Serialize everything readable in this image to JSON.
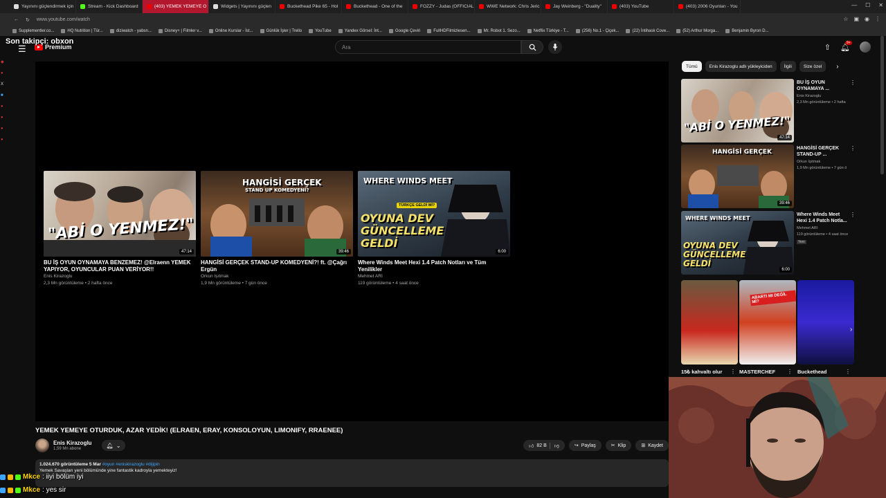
{
  "browser": {
    "tabs": [
      {
        "label": "Yayınını güçlendirmek için",
        "fav": "wh"
      },
      {
        "label": "Stream - Kick Dashboard",
        "fav": "kick"
      },
      {
        "label": "(403) YEMEK YEMEYE O",
        "fav": "yt",
        "active": true
      },
      {
        "label": "Widgets | Yayınını güçlen",
        "fav": "wh"
      },
      {
        "label": "Buckethead Pike 65 - Hol",
        "fav": "yt"
      },
      {
        "label": "Buckethead - One of the",
        "fav": "yt"
      },
      {
        "label": "FOZZY - Judas (OFFICIAL",
        "fav": "yt"
      },
      {
        "label": "WWE Network: Chris Jeric",
        "fav": "yt"
      },
      {
        "label": "Jay Weinberg - \"Duality\"",
        "fav": "yt"
      },
      {
        "label": "(403) YouTube",
        "fav": "yt"
      },
      {
        "label": "(403) 2006 Oyunları - You",
        "fav": "yt"
      }
    ],
    "url": "www.youtube.com/watch",
    "bookmarks": [
      "Supplementler.co...",
      "HQ Nutrition | Tür...",
      "diziwatch - yabsn...",
      "Disney+ | Filmler v...",
      "Online Kurslar - İst...",
      "Günlük İşler | Trello",
      "YouTube",
      "Yandex Görsel: İnt...",
      "Google Çeviri",
      "FullHDFilmizlesen...",
      "Mr. Robot 1. Sezo...",
      "Netflix Türkiye - T...",
      "(256) No.1 - Çiçek...",
      "(22) İntihask Cove...",
      "(52) Arthur Morga...",
      "Benjamin Byron D..."
    ]
  },
  "overlay": {
    "last_follower": "Son takipçi: obxon"
  },
  "header": {
    "logo_label": "Premium",
    "search_placeholder": "Ara",
    "notif_count": "9+"
  },
  "endcards": [
    {
      "title": "BU İŞ OYUN OYNAMAYA BENZEMEZ! @Elraenn YEMEK YAPIYOR, OYUNCULAR PUAN VERİYOR!!",
      "channel": "Enis Kirazoglu",
      "meta": "2,3 Mn görüntüleme • 2 hafta önce",
      "duration": "47:14",
      "thumb_text": "\"ABİ O YENMEZ!\""
    },
    {
      "title": "HANGİSİ GERÇEK STAND-UP KOMEDYENİ?! ft. @Çağrı Ergün",
      "channel": "Orkun Işıtmak",
      "meta": "1,9 Mn görüntüleme • 7 gün önce",
      "duration": "39:46",
      "thumb_text": "HANGİSİ GERÇEK",
      "thumb_sub": "STAND UP KOMEDYENİ?"
    },
    {
      "title": "Where Winds Meet Hexi 1.4 Patch Notları ve Tüm Yenilikler",
      "channel": "Mehmet ARI",
      "meta": "119 görüntüleme • 4 saat önce",
      "duration": "6:00",
      "thumb_text": "OYUNA DEV GÜNCELLEME GELDİ",
      "thumb_top": "WHERE WINDS MEET",
      "thumb_badge": "TÜRKÇE GELDİ Mİ?"
    }
  ],
  "video": {
    "title": "YEMEK YEMEYE OTURDUK, AZAR YEDİK! (ELRAEN, ERAY, KONSOLOYUN, LIMONIFY, RRAENEE)",
    "channel": "Enis Kirazoglu",
    "subs": "1,59 Mn abone",
    "likes": "82 B",
    "share": "Paylaş",
    "clip": "Klip",
    "save": "Kaydet",
    "views_date": "1.024.670 görüntüleme  5 Mar",
    "tags": "#oyun #eniskirazoglu #dijipin",
    "desc_line": "Yemek Savaşları yeni bölümünde yine fantastik kadroyla yemekteyiz!"
  },
  "sidebar": {
    "chips": [
      "Tümü",
      "Enis Kirazoglu adlı yükleyiciden",
      "İlgili",
      "Size özel"
    ],
    "recs": [
      {
        "title": "BU İŞ OYUN OYNAMAYA ...",
        "channel": "Enis Kirazoglu",
        "meta": "2,3 Mn görüntüleme • 2 hafta",
        "duration": "47:14"
      },
      {
        "title": "HANGİSİ GERÇEK STAND-UP ...",
        "channel": "Orkun Işıtmak",
        "meta": "1,9 Mn görüntüleme • 7 gün ö",
        "duration": "39:46"
      },
      {
        "title": "Where Winds Meet Hexi 1.4 Patch Notla...",
        "channel": "Mehmet ARI",
        "meta": "119 görüntüleme • 4 saat önce",
        "duration": "6:00",
        "badge": "Yeni"
      }
    ],
    "shorts": [
      {
        "label": "15₺ kahvaltı olur"
      },
      {
        "label": "MASTERCHEF"
      },
      {
        "label": "Buckethead"
      }
    ],
    "short_sign": "ABARTI MI DEĞİL Mİ?"
  },
  "chat": [
    {
      "user": "Mkce",
      "msg": ": iiyi bölüm iyi"
    },
    {
      "user": "Mkce",
      "msg": ": yes sir"
    }
  ],
  "colors": {
    "accent": "#ff0000",
    "bg": "#0f0f0f",
    "link": "#3ea6ff",
    "chat_name": "#ffd400"
  }
}
